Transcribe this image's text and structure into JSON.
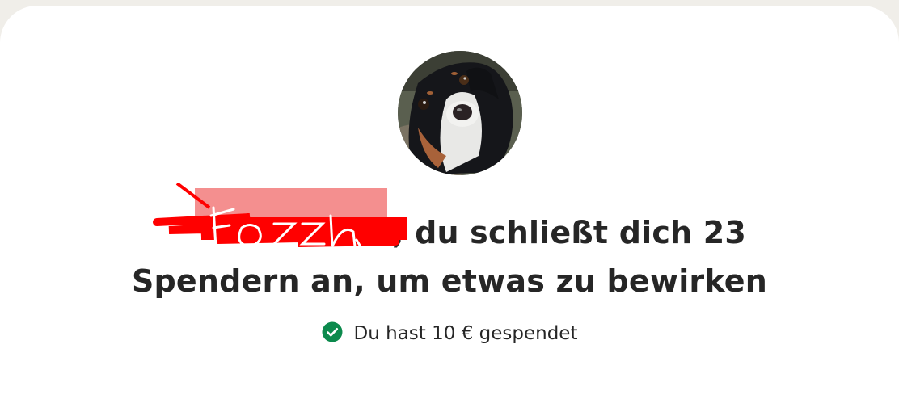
{
  "fundraiser": {
    "donor_name_redacted": "",
    "headline_line1": "du schließt dich 23",
    "headline_line2": "Spendern an, um etwas zu bewirken",
    "donated_text": "Du hast 10 € gespendet"
  },
  "colors": {
    "background": "#f0eee9",
    "card": "#ffffff",
    "text": "#262626",
    "success_green": "#0c8a4d",
    "redaction_red": "#ff0000",
    "redaction_pink": "#f48f8f"
  },
  "icons": {
    "status": "check-circle-icon",
    "avatar": "dog-photo"
  }
}
